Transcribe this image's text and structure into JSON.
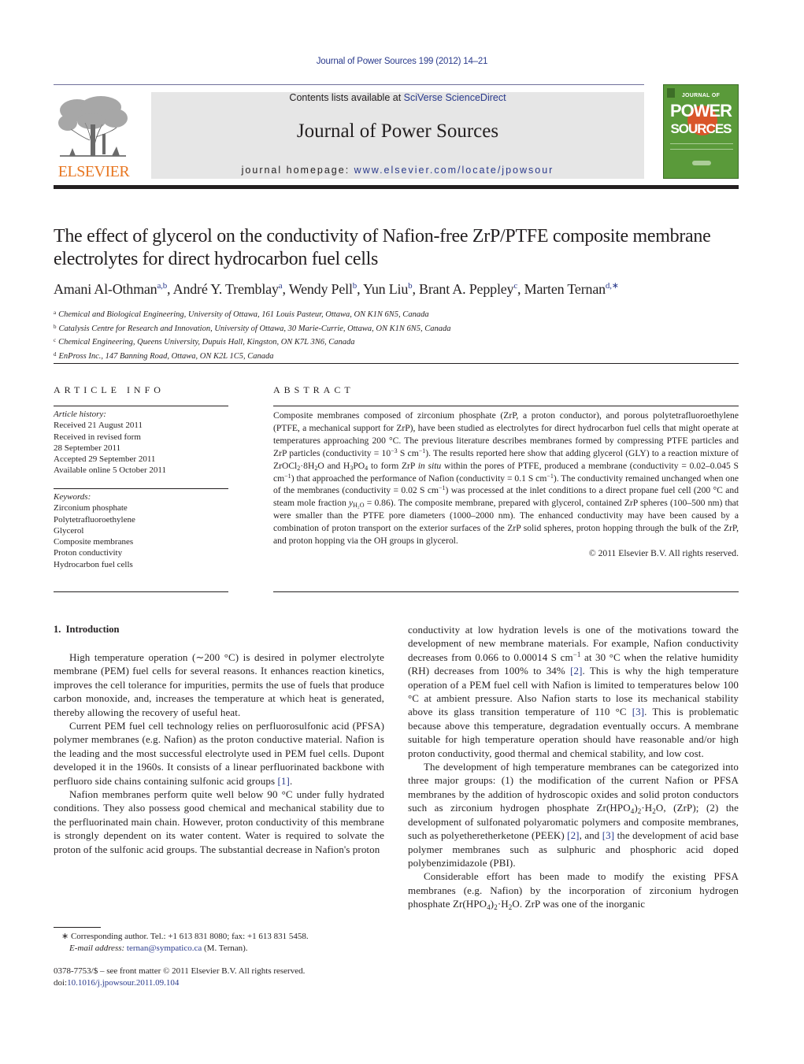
{
  "running_head": "Journal of Power Sources 199 (2012) 14–21",
  "masthead": {
    "contents_prefix": "Contents lists available at ",
    "contents_link": "SciVerse ScienceDirect",
    "journal_name": "Journal of Power Sources",
    "homepage_prefix": "journal homepage: ",
    "homepage_link": "www.elsevier.com/locate/jpowsour",
    "publisher_wordmark": "ELSEVIER",
    "cover": {
      "line1": "JOURNAL OF",
      "line2": "POWER",
      "line3": "SOURCES"
    }
  },
  "colors": {
    "link": "#2a3a8c",
    "elsevier_orange": "#e87722",
    "masthead_bg": "#e6e6e6",
    "cover_green": "#5a9a3a",
    "cover_orange": "#d9552a"
  },
  "article": {
    "title": "The effect of glycerol on the conductivity of Nafion-free ZrP/PTFE composite membrane electrolytes for direct hydrocarbon fuel cells",
    "authors": [
      {
        "name": "Amani Al-Othman",
        "marks": "a,b"
      },
      {
        "name": "André Y. Tremblay",
        "marks": "a"
      },
      {
        "name": "Wendy Pell",
        "marks": "b"
      },
      {
        "name": "Yun Liu",
        "marks": "b"
      },
      {
        "name": "Brant A. Peppley",
        "marks": "c"
      },
      {
        "name": "Marten Ternan",
        "marks": "d,∗"
      }
    ],
    "affiliations": [
      {
        "mark": "a",
        "text": "Chemical and Biological Engineering, University of Ottawa, 161 Louis Pasteur, Ottawa, ON K1N 6N5, Canada"
      },
      {
        "mark": "b",
        "text": "Catalysis Centre for Research and Innovation, University of Ottawa, 30 Marie-Currie, Ottawa, ON K1N 6N5, Canada"
      },
      {
        "mark": "c",
        "text": "Chemical Engineering, Queens University, Dupuis Hall, Kingston, ON K7L 3N6, Canada"
      },
      {
        "mark": "d",
        "text": "EnPross Inc., 147 Banning Road, Ottawa, ON K2L 1C5, Canada"
      }
    ]
  },
  "article_info": {
    "heading": "ARTICLE INFO",
    "history_label": "Article history:",
    "history": [
      "Received 21 August 2011",
      "Received in revised form",
      "28 September 2011",
      "Accepted 29 September 2011",
      "Available online 5 October 2011"
    ],
    "keywords_label": "Keywords:",
    "keywords": [
      "Zirconium phosphate",
      "Polytetrafluoroethylene",
      "Glycerol",
      "Composite membranes",
      "Proton conductivity",
      "Hydrocarbon fuel cells"
    ]
  },
  "abstract": {
    "heading": "ABSTRACT",
    "s1": "Composite membranes composed of zirconium phosphate (ZrP, a proton conductor), and porous polytetrafluoroethylene (PTFE, a mechanical support for ZrP), have been studied as electrolytes for direct hydrocarbon fuel cells that might operate at temperatures approaching 200 °C. The previous literature describes membranes formed by compressing PTFE particles and ZrP particles (conductivity = 10",
    "s1_exp": "−3",
    "s1_unit": " S cm",
    "s1_unit_exp": "−1",
    "s2": "). The results reported here show that adding glycerol (GLY) to a reaction mixture of ZrOCl",
    "s2_sub1": "2",
    "s2_b": "·8H",
    "s2_sub2": "2",
    "s2_c": "O and H",
    "s2_sub3": "3",
    "s2_d": "PO",
    "s2_sub4": "4",
    "s2_e": " to form ZrP ",
    "s2_italic": "in situ",
    "s2_f": " within the pores of PTFE, produced a membrane (conductivity = 0.02–0.045 S cm",
    "s2_exp1": "−1",
    "s2_g": ") that approached the performance of Nafion (conductivity = 0.1 S cm",
    "s2_exp2": "−1",
    "s2_h": "). The conductivity remained unchanged when one of the membranes (conductivity = 0.02 S cm",
    "s2_exp3": "−1",
    "s2_i": ") was processed at the inlet conditions to a direct propane fuel cell (200 °C and steam mole fraction ",
    "s2_y": "y",
    "s2_ysub": "H₂O",
    "s2_j": " = 0.86). The composite membrane, prepared with glycerol, contained ZrP spheres (100–500 nm) that were smaller than the PTFE pore diameters (1000–2000 nm). The enhanced conductivity may have been caused by a combination of proton transport on the exterior surfaces of the ZrP solid spheres, proton hopping through the bulk of the ZrP, and proton hopping via the OH groups in glycerol.",
    "copyright": "© 2011 Elsevier B.V. All rights reserved."
  },
  "body": {
    "section_heading": "1.  Introduction",
    "left": {
      "p1": "High temperature operation (∼200 °C) is desired in polymer electrolyte membrane (PEM) fuel cells for several reasons. It enhances reaction kinetics, improves the cell tolerance for impurities, permits the use of fuels that produce carbon monoxide, and, increases the temperature at which heat is generated, thereby allowing the recovery of useful heat.",
      "p2": "Current PEM fuel cell technology relies on perfluorosulfonic acid (PFSA) polymer membranes (e.g. Nafion) as the proton conductive material. Nafion is the leading and the most successful electrolyte used in PEM fuel cells. Dupont developed it in the 1960s. It consists of a linear perfluorinated backbone with perfluoro side chains containing sulfonic acid groups ",
      "p2_ref": "[1]",
      "p2_end": ".",
      "p3": "Nafion membranes perform quite well below 90 °C under fully hydrated conditions. They also possess good chemical and mechanical stability due to the perfluorinated main chain. However, proton conductivity of this membrane is strongly dependent on its water content. Water is required to solvate the proton of the sulfonic acid groups. The substantial decrease in Nafion's proton"
    },
    "right": {
      "p1a": "conductivity at low hydration levels is one of the motivations toward the development of new membrane materials. For example, Nafion conductivity decreases from 0.066 to 0.00014 S cm",
      "p1_exp": "−1",
      "p1b": " at 30 °C when the relative humidity (RH) decreases from 100% to 34% ",
      "p1_ref1": "[2]",
      "p1c": ". This is why the high temperature operation of a PEM fuel cell with Nafion is limited to temperatures below 100 °C at ambient pressure. Also Nafion starts to lose its mechanical stability above its glass transition temperature of 110 °C ",
      "p1_ref2": "[3]",
      "p1d": ". This is problematic because above this temperature, degradation eventually occurs. A membrane suitable for high temperature operation should have reasonable and/or high proton conductivity, good thermal and chemical stability, and low cost.",
      "p2a": "The development of high temperature membranes can be categorized into three major groups: (1) the modification of the current Nafion or PFSA membranes by the addition of hydroscopic oxides and solid proton conductors such as zirconium hydrogen phosphate Zr(HPO",
      "p2_sub1": "4",
      "p2b": ")",
      "p2_sub2": "2",
      "p2c": "·H",
      "p2_sub3": "2",
      "p2d": "O, (ZrP); (2) the development of sulfonated polyaromatic polymers and composite membranes, such as polyetheretherketone (PEEK) ",
      "p2_ref1": "[2]",
      "p2e": ", and ",
      "p2_ref2": "[3]",
      "p2f": " the development of acid base polymer membranes such as sulphuric and phosphoric acid doped polybenzimidazole (PBI).",
      "p3a": "Considerable effort has been made to modify the existing PFSA membranes (e.g. Nafion) by the incorporation of zirconium hydrogen phosphate Zr(HPO",
      "p3_sub1": "4",
      "p3b": ")",
      "p3_sub2": "2",
      "p3c": "·H",
      "p3_sub3": "2",
      "p3d": "O. ZrP was one of the inorganic"
    }
  },
  "footnote": {
    "star": "∗",
    "corresponding": " Corresponding author. Tel.: +1 613 831 8080; fax: +1 613 831 5458.",
    "email_label": "E-mail address:",
    "email": "ternan@sympatico.ca",
    "email_suffix": " (M. Ternan)."
  },
  "frontmatter": {
    "line1": "0378-7753/$ – see front matter © 2011 Elsevier B.V. All rights reserved.",
    "doi_prefix": "doi:",
    "doi": "10.1016/j.jpowsour.2011.09.104"
  }
}
